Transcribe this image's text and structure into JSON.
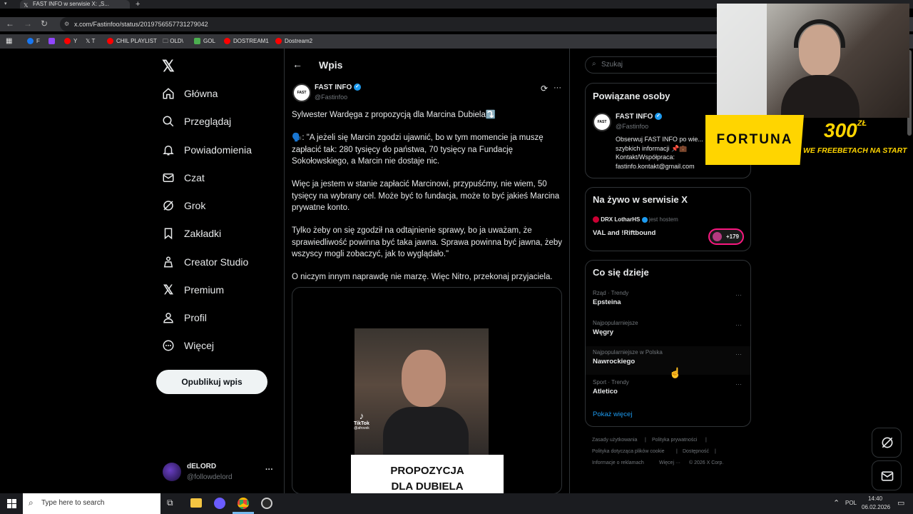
{
  "browser": {
    "tab_title": "FAST INFO w serwisie X: „S...",
    "url": "x.com/Fastinfoo/status/2019756557731279042",
    "bookmarks": [
      "F",
      "Y",
      "T",
      "CHIL PLAYLIST",
      "OLD\\",
      "GOL",
      "DOSTREAM1",
      "Dostream2"
    ]
  },
  "nav": {
    "items": [
      "Główna",
      "Przeglądaj",
      "Powiadomienia",
      "Czat",
      "Grok",
      "Zakładki",
      "Creator Studio",
      "Premium",
      "Profil",
      "Więcej"
    ],
    "post_button": "Opublikuj wpis",
    "user_name": "dELORD",
    "user_handle": "@followdelord",
    "user_more": "···"
  },
  "post": {
    "header_title": "Wpis",
    "author_name": "FAST INFO",
    "author_handle": "@Fastinfoo",
    "author_avatar_text": "FAST",
    "more": "···",
    "headline": "Sylwester Wardęga z propozycją dla Marcina Dubiela⤵️",
    "para1": "🗣️: \"A jeżeli się Marcin zgodzi ujawnić, bo w tym momencie ja muszę zapłacić tak: 280 tysięcy do państwa, 70 tysięcy na Fundację Sokołowskiego, a Marcin nie dostaje nic.",
    "para2": "Więc ja jestem w stanie zapłacić Marcinowi, przypuśćmy, nie wiem, 50 tysięcy na wybrany cel. Może być to fundacja, może to być jakieś Marcina prywatne konto.",
    "para3": "Tylko żeby on się zgodził na odtajnienie sprawy, bo ja uważam, że sprawiedliwość powinna być taka jawna. Sprawa powinna być jawna, żeby wszyscy mogli zobaczyć, jak to wyglądało.\"",
    "para4": "O niczym innym naprawdę nie marzę. Więc Nitro, przekonaj przyjaciela.",
    "video_caption_line1": "PROPOZYCJA",
    "video_caption_line2": "DLA DUBIELA",
    "tiktok_label": "TikTok",
    "tiktok_handle": "@afrovek"
  },
  "right": {
    "search_placeholder": "Szukaj",
    "related_title": "Powiązane osoby",
    "related_name": "FAST INFO",
    "related_handle": "@Fastinfoo",
    "related_avatar_text": "FAST",
    "related_bio": "Obserwuj FAST INFO po wie... szybkich informacji 📌💼 Kontakt/Współpraca: fastinfo.kontakt@gmail.com",
    "live_title": "Na żywo w serwisie X",
    "live_host": "DRX LotharHS",
    "live_host_suffix": "jest hostem",
    "live_topic": "VAL and !Riftbound",
    "live_count": "+179",
    "trends_title": "Co się dzieje",
    "trends": [
      {
        "context": "Rząd · Trendy",
        "name": "Epsteina",
        "more": "···"
      },
      {
        "context": "Najpopularniejsze",
        "name": "Węgry",
        "more": "···"
      },
      {
        "context": "Najpopularniejsze w Polska",
        "name": "Nawrockiego",
        "more": "···"
      },
      {
        "context": "Sport · Trendy",
        "name": "Atletico",
        "more": "···"
      }
    ],
    "show_more": "Pokaż więcej",
    "footer": [
      "Zasady użytkowania",
      "|",
      "Polityka prywatności",
      "|",
      "Polityka dotycząca plików cookie",
      "|",
      "Dostępność",
      "|",
      "Informacje o reklamach",
      "Więcej ···",
      "© 2026 X Corp."
    ]
  },
  "overlay": {
    "brand": "FORTUNA",
    "amount": "300",
    "currency": "ZŁ",
    "tagline": "WE FREEBETACH NA START"
  },
  "taskbar": {
    "search_placeholder": "Type here to search",
    "lang": "POL",
    "time": "14:40",
    "date": "06.02.2026"
  },
  "colors": {
    "accent": "#1d9bf0",
    "fortuna_yellow": "#ffd500",
    "fortuna_text": "#0a0a0a",
    "live_pink": "#f91880"
  }
}
